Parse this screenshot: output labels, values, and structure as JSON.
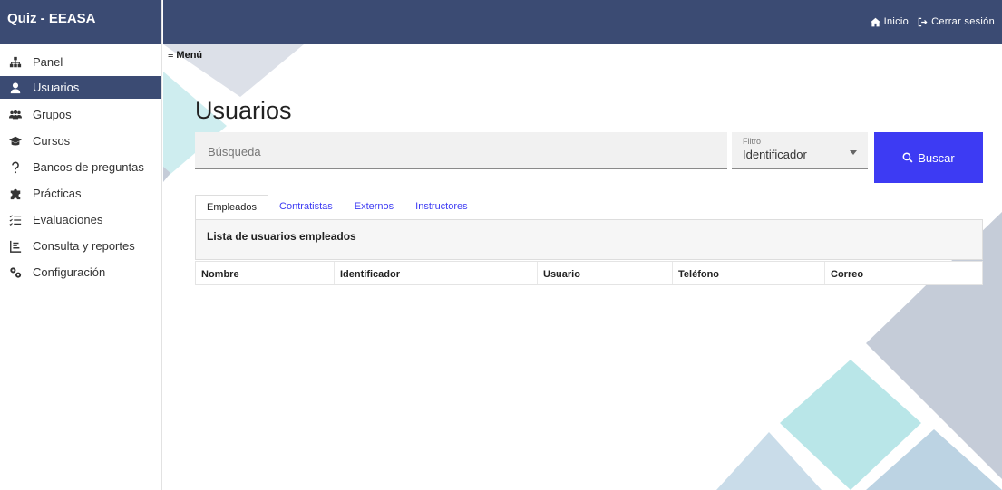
{
  "app": {
    "title": "Quiz - EEASA"
  },
  "header": {
    "links": [
      {
        "label": "Inicio",
        "icon": "home-icon"
      },
      {
        "label": "Cerrar sesión",
        "icon": "logout-icon"
      }
    ]
  },
  "sidebar": {
    "items": [
      {
        "label": "Panel",
        "icon": "sitemap-icon"
      },
      {
        "label": "Usuarios",
        "icon": "user-icon",
        "active": true
      },
      {
        "label": "Grupos",
        "icon": "users-icon"
      },
      {
        "label": "Cursos",
        "icon": "graduation-cap-icon"
      },
      {
        "label": "Bancos de preguntas",
        "icon": "question-icon"
      },
      {
        "label": "Prácticas",
        "icon": "puzzle-icon"
      },
      {
        "label": "Evaluaciones",
        "icon": "list-icon"
      },
      {
        "label": "Consulta y reportes",
        "icon": "report-icon"
      },
      {
        "label": "Configuración",
        "icon": "gears-icon"
      }
    ]
  },
  "main": {
    "menu_label": "Menú",
    "page_title": "Usuarios",
    "search": {
      "placeholder": "Búsqueda",
      "value": ""
    },
    "filter": {
      "label": "Filtro",
      "value": "Identificador"
    },
    "search_button": "Buscar",
    "tabs": [
      {
        "label": "Empleados",
        "active": true
      },
      {
        "label": "Contratistas"
      },
      {
        "label": "Externos"
      },
      {
        "label": "Instructores"
      }
    ],
    "panel_title": "Lista de usuarios empleados",
    "table": {
      "columns": [
        "Nombre",
        "Identificador",
        "Usuario",
        "Teléfono",
        "Correo",
        ""
      ]
    }
  },
  "colors": {
    "header_bg": "#3b4b73",
    "accent": "#3d3bf3",
    "shape_teal": "#b9e6e8",
    "shape_grey": "#c5ccd8",
    "shape_blue": "#bcd3e3"
  }
}
